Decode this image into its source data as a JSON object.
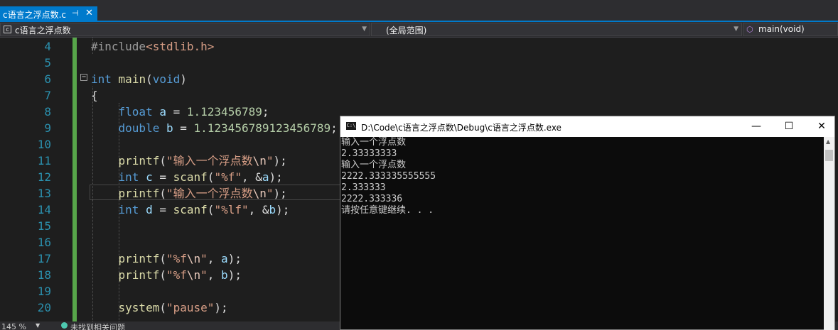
{
  "tab": {
    "title": "c语言之浮点数.c",
    "pin": "⊣",
    "close": "✕"
  },
  "navbar": {
    "file": "c语言之浮点数",
    "scope": "(全局范围)",
    "member": "main(void)"
  },
  "editor": {
    "lines": [
      {
        "n": "4",
        "parts": [
          [
            "pp",
            "#include"
          ],
          [
            "inc",
            "<stdlib.h>"
          ]
        ]
      },
      {
        "n": "5",
        "parts": []
      },
      {
        "n": "6",
        "parts": [
          [
            "kw",
            "int"
          ],
          [
            "",
            " "
          ],
          [
            "fn",
            "main"
          ],
          [
            "",
            "("
          ],
          [
            "kw",
            "void"
          ],
          [
            "",
            ")"
          ]
        ]
      },
      {
        "n": "7",
        "parts": [
          [
            "",
            "{"
          ]
        ]
      },
      {
        "n": "8",
        "parts": [
          [
            "",
            "    "
          ],
          [
            "kw",
            "float"
          ],
          [
            "",
            " "
          ],
          [
            "var",
            "a"
          ],
          [
            "",
            " = "
          ],
          [
            "num",
            "1.123456789"
          ],
          [
            "",
            ";"
          ]
        ]
      },
      {
        "n": "9",
        "parts": [
          [
            "",
            "    "
          ],
          [
            "kw",
            "double"
          ],
          [
            "",
            " "
          ],
          [
            "var",
            "b"
          ],
          [
            "",
            " = "
          ],
          [
            "num",
            "1.123456789123456789"
          ],
          [
            "",
            ";"
          ]
        ]
      },
      {
        "n": "10",
        "parts": []
      },
      {
        "n": "11",
        "parts": [
          [
            "",
            "    "
          ],
          [
            "fn",
            "printf"
          ],
          [
            "",
            "("
          ],
          [
            "str",
            "\"输入一个浮点数"
          ],
          [
            "esc",
            "\\n"
          ],
          [
            "str",
            "\""
          ],
          [
            "",
            ");"
          ]
        ]
      },
      {
        "n": "12",
        "parts": [
          [
            "",
            "    "
          ],
          [
            "kw",
            "int"
          ],
          [
            "",
            " "
          ],
          [
            "var",
            "c"
          ],
          [
            "",
            " = "
          ],
          [
            "fn",
            "scanf"
          ],
          [
            "",
            "("
          ],
          [
            "str",
            "\"%f\""
          ],
          [
            "",
            ", &"
          ],
          [
            "var",
            "a"
          ],
          [
            "",
            ");"
          ]
        ]
      },
      {
        "n": "13",
        "parts": [
          [
            "",
            "    "
          ],
          [
            "fn",
            "printf"
          ],
          [
            "",
            "("
          ],
          [
            "str",
            "\"输入一个浮点数"
          ],
          [
            "esc",
            "\\n"
          ],
          [
            "str",
            "\""
          ],
          [
            "",
            ");"
          ]
        ]
      },
      {
        "n": "14",
        "parts": [
          [
            "",
            "    "
          ],
          [
            "kw",
            "int"
          ],
          [
            "",
            " "
          ],
          [
            "var",
            "d"
          ],
          [
            "",
            " = "
          ],
          [
            "fn",
            "scanf"
          ],
          [
            "",
            "("
          ],
          [
            "str",
            "\"%lf\""
          ],
          [
            "",
            ", &"
          ],
          [
            "var",
            "b"
          ],
          [
            "",
            ");"
          ]
        ]
      },
      {
        "n": "15",
        "parts": []
      },
      {
        "n": "16",
        "parts": []
      },
      {
        "n": "17",
        "parts": [
          [
            "",
            "    "
          ],
          [
            "fn",
            "printf"
          ],
          [
            "",
            "("
          ],
          [
            "str",
            "\"%f"
          ],
          [
            "esc",
            "\\n"
          ],
          [
            "str",
            "\""
          ],
          [
            "",
            ", "
          ],
          [
            "var",
            "a"
          ],
          [
            "",
            ");"
          ]
        ]
      },
      {
        "n": "18",
        "parts": [
          [
            "",
            "    "
          ],
          [
            "fn",
            "printf"
          ],
          [
            "",
            "("
          ],
          [
            "str",
            "\"%f"
          ],
          [
            "esc",
            "\\n"
          ],
          [
            "str",
            "\""
          ],
          [
            "",
            ", "
          ],
          [
            "var",
            "b"
          ],
          [
            "",
            ");"
          ]
        ]
      },
      {
        "n": "19",
        "parts": []
      },
      {
        "n": "20",
        "parts": [
          [
            "",
            "    "
          ],
          [
            "fn",
            "system"
          ],
          [
            "",
            "("
          ],
          [
            "str",
            "\"pause\""
          ],
          [
            "",
            ");"
          ]
        ]
      }
    ]
  },
  "status": {
    "zoom": "145 %",
    "issues": "未找到相关问题"
  },
  "console": {
    "title": "D:\\Code\\c语言之浮点数\\Debug\\c语言之浮点数.exe",
    "icon_text": "C:\\",
    "minimize": "—",
    "maximize": "☐",
    "close": "✕",
    "lines": [
      "输入一个浮点数",
      "2.33333333",
      "输入一个浮点数",
      "2222.333335555555",
      "2.333333",
      "2222.333336",
      "请按任意键继续. . ."
    ]
  },
  "colors": {
    "accent": "#007acc",
    "editor_bg": "#1e1e1e",
    "change_bar": "#57a64a",
    "console_bg": "#0c0c0c"
  }
}
